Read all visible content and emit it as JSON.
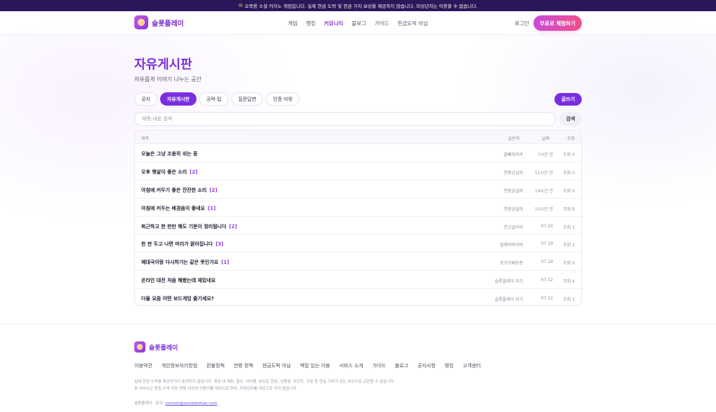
{
  "notice": {
    "mark": "✉",
    "text": "오락용 소셜 카지노 게임입니다. 실제 현금 도박 및 현금 가치 보상을 제공하지 않습니다. 미성년자는 이용할 수 없습니다."
  },
  "header": {
    "logo_text": "슬롯플레이",
    "nav": [
      "게임",
      "랭킹",
      "커뮤니티",
      "블로그",
      "가이드",
      "현금도박 아님"
    ],
    "active_nav": "커뮤니티",
    "login": "로그인",
    "cta": "무료로 체험하기"
  },
  "page": {
    "title": "자유게시판",
    "subtitle": "자유롭게 이야기 나누는 공간",
    "tabs": [
      "공지",
      "자유게시판",
      "공략·팁",
      "질문답변",
      "인증·자랑"
    ],
    "active_tab": "자유게시판",
    "write_button": "글쓰기",
    "search_placeholder": "제목·내용 검색",
    "search_button": "검색"
  },
  "board": {
    "columns": {
      "title": "제목",
      "author": "글쓴이",
      "date": "날짜",
      "views": "조회"
    },
    "rows": [
      {
        "title": "오늘은 그냥 조용히 쉬는 중",
        "comments": "",
        "author": "올빼미러라",
        "date": "7시간 전",
        "views": "조회 0"
      },
      {
        "title": "오후 햇살이 좋은 소리",
        "comments": "[2]",
        "author": "연중금실마",
        "date": "11시간 전",
        "views": "조회 0"
      },
      {
        "title": "아침에 커두기 좋은 잔잔한 소리",
        "comments": "[2]",
        "author": "연중금실마",
        "date": "14시간 전",
        "views": "조회 0"
      },
      {
        "title": "아침에 커두는 배경음이 좋네요",
        "comments": "[1]",
        "author": "연중금실마",
        "date": "15시간 전",
        "views": "조회 0"
      },
      {
        "title": "퇴근하고 한 판만 해도 기분이 정리됩니다",
        "comments": "[2]",
        "author": "연고일러야",
        "date": "07.20",
        "views": "조회 1"
      },
      {
        "title": "한 판 두고 나면 머리가 맑아집니다",
        "comments": "[3]",
        "author": "밀레의여자비",
        "date": "07.19",
        "views": "조회 2"
      },
      {
        "title": "체대국이랑 다시하기는 같은 뜻인가요",
        "comments": "[1]",
        "author": "초코카페토퀸",
        "date": "07.19",
        "views": "조회 0"
      },
      {
        "title": "온라인 대전 처음 해봤는데 재밌네요",
        "comments": "",
        "author": "슬롯플레이 지기",
        "date": "07.12",
        "views": "조회 4"
      },
      {
        "title": "다들 요즘 어떤 보드게임 즐기세요?",
        "comments": "",
        "author": "슬롯플레이 지기",
        "date": "07.12",
        "views": "조회 1"
      }
    ]
  },
  "footer": {
    "logo_text": "슬롯플레이",
    "links": [
      "이용약관",
      "개인정보처리방침",
      "환불정책",
      "연령 정책",
      "현금도박 아님",
      "책임 있는 이용",
      "서비스 소개",
      "가이드",
      "블로그",
      "공지사항",
      "랭킹",
      "고객센터"
    ],
    "note1": "실제 현금 도박을 제공하거나 중개하지 않습니다. 게임 내 재화, 점수, 아이템, 보상은 현금, 상품권, 포인트, 쿠폰 등 현실 가치가 있는 보상으로 교환할 수 없습니다.",
    "note2": "본 서비스는 방침 도박 가능 연령 이상의 이용자를 대상으로 하며, 미성년자를 대상으로 하지 않습니다.",
    "contact_label": "슬롯플레이 · 문의:",
    "contact_email": "contact@socialslotsac.com"
  }
}
